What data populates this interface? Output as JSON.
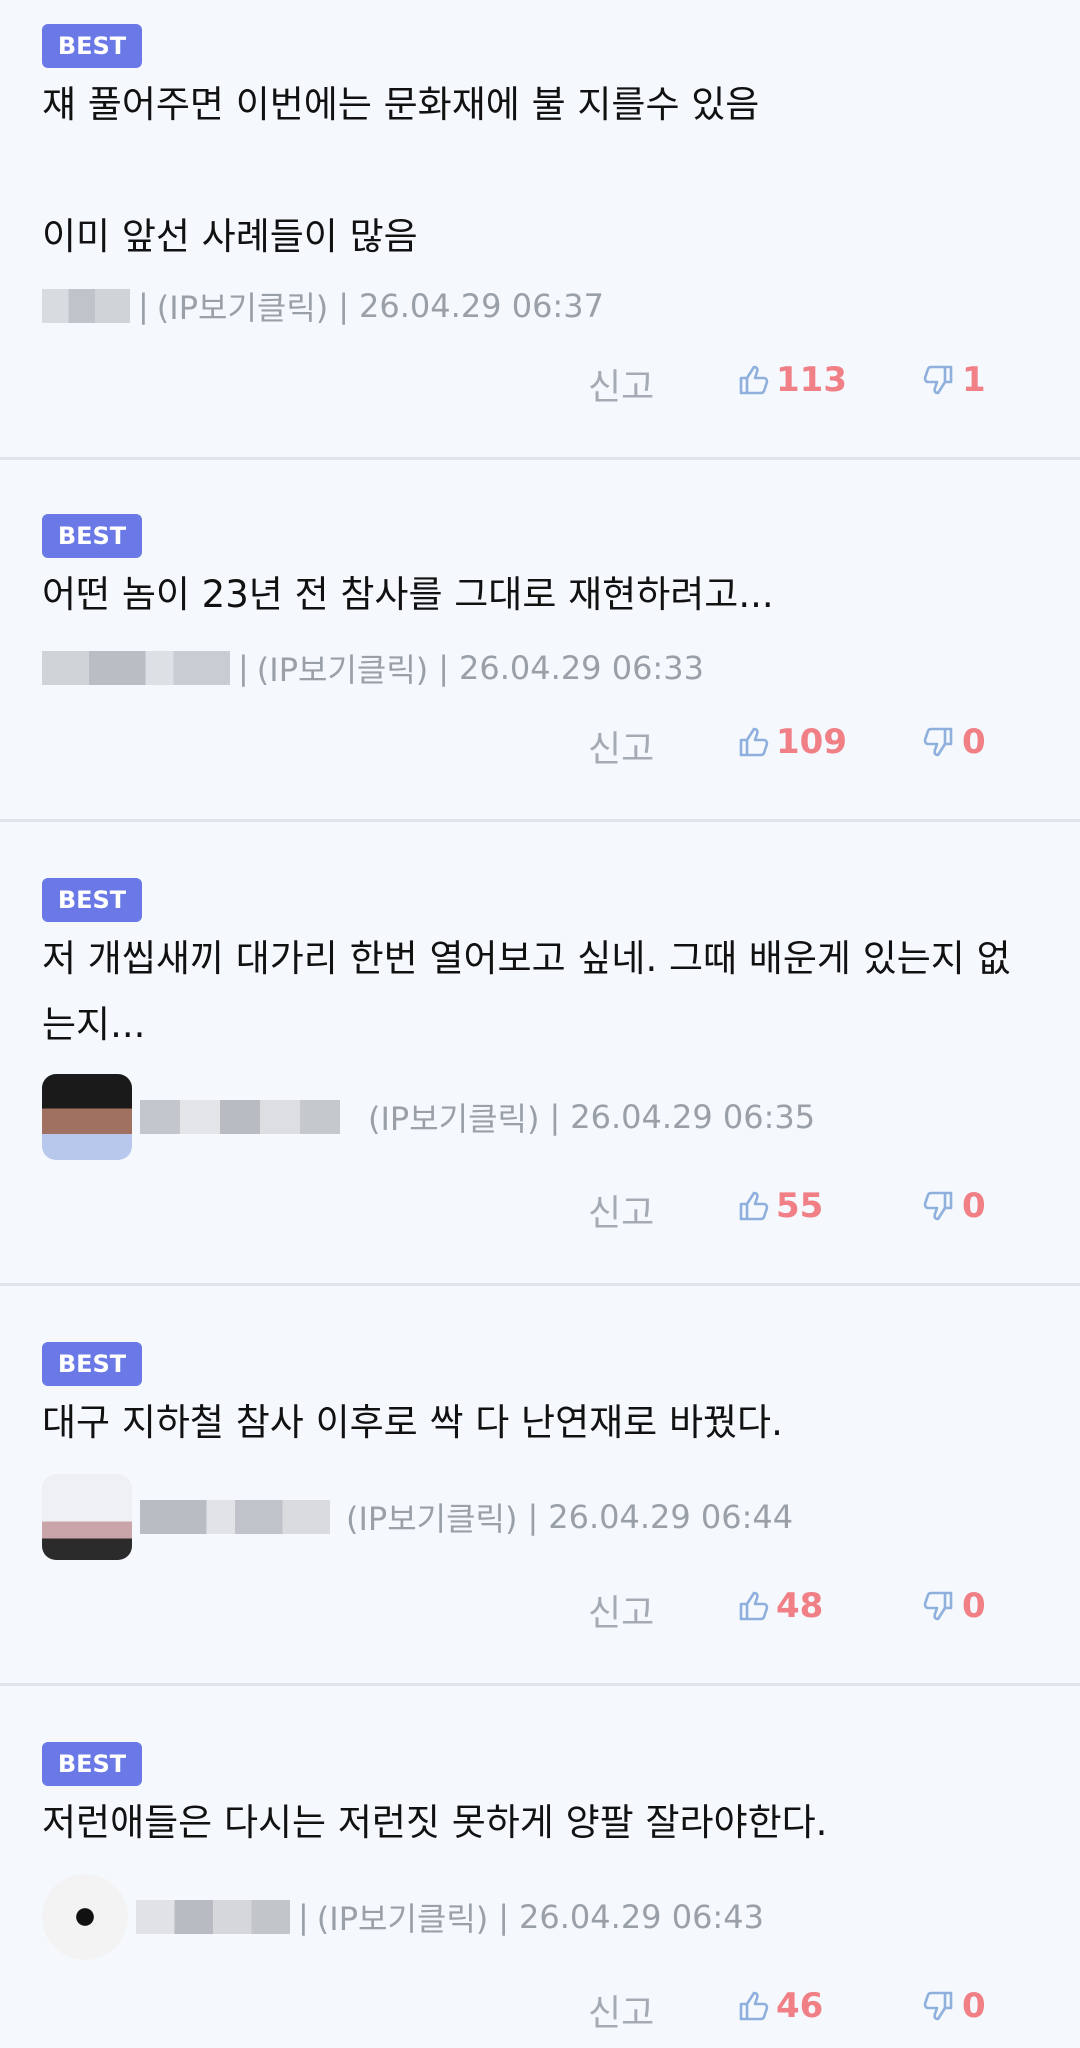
{
  "colors": {
    "background": "#f5f8fd",
    "badge": "#6b79e6",
    "count": "#f07f86",
    "thumb": "#8fb0dc",
    "meta": "#9aa0a8",
    "divider": "#dfe3ea"
  },
  "report_label": "신고",
  "comments": [
    {
      "badge": "BEST",
      "text": "쟤 풀어주면 이번에는 문화재에 불 지를수 있음\n\n이미 앞선 사례들이 많음",
      "sep": "|",
      "ip": "(IP보기클릭)",
      "date": "26.04.29 06:37",
      "likes": "113",
      "dislikes": "1"
    },
    {
      "badge": "BEST",
      "text": "어떤 놈이 23년 전 참사를 그대로 재현하려고...",
      "sep": "|",
      "ip": "(IP보기클릭)",
      "date": "26.04.29 06:33",
      "likes": "109",
      "dislikes": "0"
    },
    {
      "badge": "BEST",
      "text": "저 개씹새끼 대가리 한번 열어보고 싶네. 그때 배운게 있는지 없는지...",
      "sep": "",
      "ip": "(IP보기클릭)",
      "date": "26.04.29 06:35",
      "likes": "55",
      "dislikes": "0"
    },
    {
      "badge": "BEST",
      "text": "대구 지하철 참사 이후로 싹 다 난연재로 바꿨다.",
      "sep": "",
      "ip": "(IP보기클릭)",
      "date": "26.04.29 06:44",
      "likes": "48",
      "dislikes": "0"
    },
    {
      "badge": "BEST",
      "text": "저런애들은 다시는 저런짓 못하게 양팔 잘라야한다.",
      "sep": "|",
      "ip": "(IP보기클릭)",
      "date": "26.04.29 06:43",
      "likes": "46",
      "dislikes": "0"
    }
  ]
}
